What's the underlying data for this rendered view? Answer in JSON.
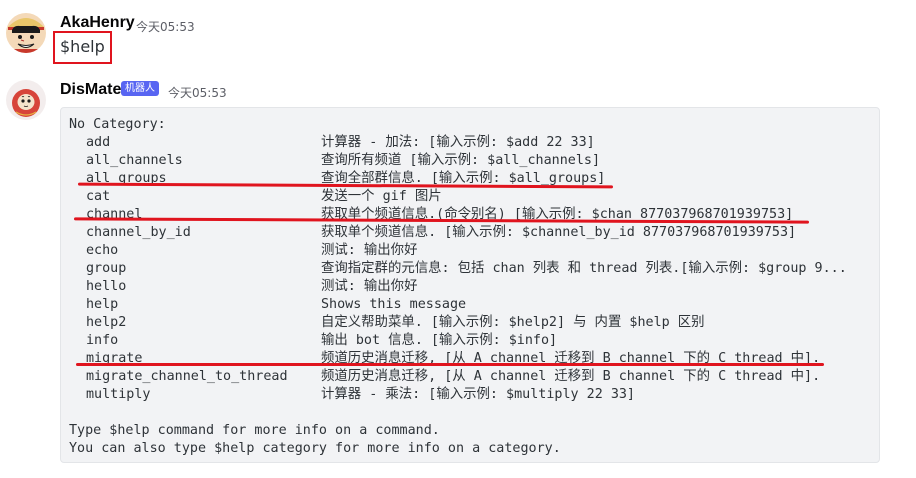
{
  "messages": [
    {
      "username": "AkaHenry",
      "timestamp": "今天05:53",
      "content": "$help"
    },
    {
      "username": "DisMate",
      "badge": "机器人",
      "timestamp": "今天05:53",
      "code": {
        "header": "No Category:",
        "commands": [
          {
            "name": "add",
            "desc": "计算器 - 加法: [输入示例: $add 22 33]"
          },
          {
            "name": "all_channels",
            "desc": "查询所有频道 [输入示例: $all_channels]"
          },
          {
            "name": "all_groups",
            "desc": "查询全部群信息. [输入示例: $all_groups]"
          },
          {
            "name": "cat",
            "desc": "发送一个 gif 图片"
          },
          {
            "name": "channel",
            "desc": "获取单个频道信息.(命令别名) [输入示例: $chan 877037968701939753]"
          },
          {
            "name": "channel_by_id",
            "desc": "获取单个频道信息. [输入示例: $channel_by_id 877037968701939753]"
          },
          {
            "name": "echo",
            "desc": "测试: 输出你好"
          },
          {
            "name": "group",
            "desc": "查询指定群的元信息: 包括 chan 列表 和 thread 列表.[输入示例: $group 9..."
          },
          {
            "name": "hello",
            "desc": "测试: 输出你好"
          },
          {
            "name": "help",
            "desc": "Shows this message"
          },
          {
            "name": "help2",
            "desc": "自定义帮助菜单. [输入示例: $help2] 与 内置 $help 区别"
          },
          {
            "name": "info",
            "desc": "输出 bot 信息. [输入示例: $info]"
          },
          {
            "name": "migrate",
            "desc": "频道历史消息迁移, [从 A channel 迁移到 B channel 下的 C thread 中]."
          },
          {
            "name": "migrate_channel_to_thread",
            "desc": "频道历史消息迁移, [从 A channel 迁移到 B channel 下的 C thread 中]."
          },
          {
            "name": "multiply",
            "desc": "计算器 - 乘法: [输入示例: $multiply 22 33]"
          }
        ],
        "footer1": "Type $help command for more info on a command.",
        "footer2": "You can also type $help category for more info on a category."
      }
    }
  ],
  "colors": {
    "annotation_red": "#e0141e",
    "bot_badge": "#5865f2",
    "code_bg": "#f2f3f5"
  },
  "icons": {
    "user_avatar": "luffy-avatar-icon",
    "bot_avatar": "daruma-avatar-icon"
  }
}
